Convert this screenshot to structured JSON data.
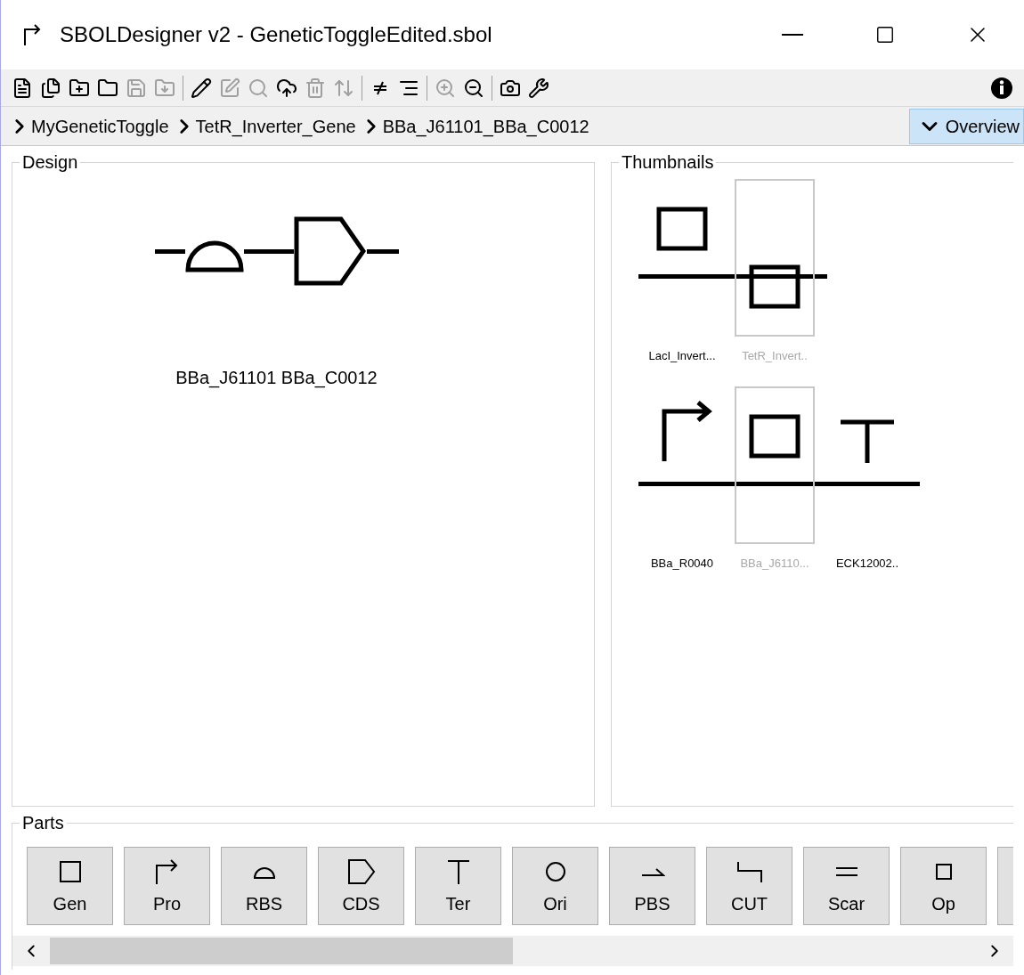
{
  "window": {
    "title": "SBOLDesigner v2 - GeneticToggleEdited.sbol"
  },
  "toolbar": [
    [
      {
        "kind": "new",
        "disabled": false
      },
      {
        "kind": "new-multiple",
        "disabled": false
      },
      {
        "kind": "add-part",
        "disabled": false
      },
      {
        "kind": "open",
        "disabled": false
      },
      {
        "kind": "save",
        "disabled": true
      },
      {
        "kind": "export",
        "disabled": true
      }
    ],
    [
      {
        "kind": "edit",
        "disabled": false
      },
      {
        "kind": "edit-box",
        "disabled": true
      },
      {
        "kind": "find",
        "disabled": true
      },
      {
        "kind": "upload",
        "disabled": false
      },
      {
        "kind": "delete",
        "disabled": true
      },
      {
        "kind": "flip",
        "disabled": true
      }
    ],
    [
      {
        "kind": "strike",
        "disabled": false
      },
      {
        "kind": "fold",
        "disabled": false
      }
    ],
    [
      {
        "kind": "zoom-in",
        "disabled": true
      },
      {
        "kind": "zoom-out",
        "disabled": false
      }
    ],
    [
      {
        "kind": "snapshot",
        "disabled": false
      },
      {
        "kind": "tools",
        "disabled": false
      }
    ]
  ],
  "breadcrumb": [
    "MyGeneticToggle",
    "TetR_Inverter_Gene",
    "BBa_J61101_BBa_C0012"
  ],
  "overview_button": {
    "label": "Overview",
    "selected": true
  },
  "design": {
    "title": "Design",
    "glyphs": [
      {
        "kind": "rbs"
      },
      {
        "kind": "cds"
      }
    ],
    "caption": "BBa_J61101 BBa_C0012"
  },
  "thumbnails": {
    "title": "Thumbnails",
    "rows": [
      [
        {
          "kind": "gene",
          "label": "LacI_Invert...",
          "selected": false
        },
        {
          "kind": "gene-reverse",
          "label": "TetR_Invert..",
          "selected": true
        }
      ],
      [
        {
          "kind": "promoter",
          "label": "BBa_R0040",
          "selected": false
        },
        {
          "kind": "gene",
          "label": "BBa_J6110...",
          "selected": true
        },
        {
          "kind": "terminator",
          "label": "ECK12002..",
          "selected": false
        }
      ]
    ]
  },
  "parts": {
    "title": "Parts",
    "items": [
      {
        "kind": "gen",
        "label": "Gen"
      },
      {
        "kind": "pro",
        "label": "Pro"
      },
      {
        "kind": "rbs",
        "label": "RBS"
      },
      {
        "kind": "cds",
        "label": "CDS"
      },
      {
        "kind": "ter",
        "label": "Ter"
      },
      {
        "kind": "ori",
        "label": "Ori"
      },
      {
        "kind": "pbs",
        "label": "PBS"
      },
      {
        "kind": "cut",
        "label": "CUT"
      },
      {
        "kind": "scar",
        "label": "Scar"
      },
      {
        "kind": "op",
        "label": "Op"
      }
    ]
  }
}
